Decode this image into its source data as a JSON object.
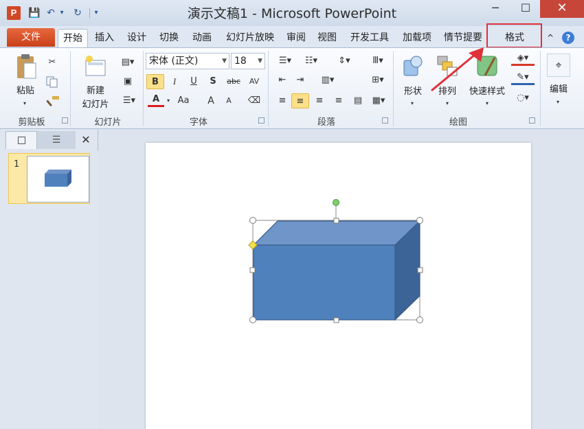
{
  "window": {
    "title": "演示文稿1 - Microsoft PowerPoint",
    "app_icon_letter": "P",
    "minimize": "─",
    "maximize": "☐",
    "close": "✕"
  },
  "quick_access": {
    "save": "💾",
    "undo": "↶",
    "undo_drop": "▾",
    "redo": "↻",
    "customize": "▾"
  },
  "tabs": {
    "file": "文件",
    "items": [
      "开始",
      "插入",
      "设计",
      "切换",
      "动画",
      "幻灯片放映",
      "审阅",
      "视图",
      "开发工具",
      "加载项",
      "情节提要",
      "格式"
    ],
    "active": "开始",
    "highlighted": "格式",
    "collapse": "^",
    "help": "?"
  },
  "ribbon": {
    "clipboard": {
      "paste": "粘贴",
      "label": "剪贴板"
    },
    "slides": {
      "new_slide_line1": "新建",
      "new_slide_line2": "幻灯片",
      "label": "幻灯片"
    },
    "font": {
      "name": "宋体 (正文)",
      "size": "18",
      "bold": "B",
      "italic": "I",
      "underline": "U",
      "shadow": "S",
      "strike": "abc",
      "spacing": "AV",
      "color": "A",
      "case": "Aa",
      "grow": "A",
      "shrink": "A",
      "label": "字体"
    },
    "paragraph": {
      "label": "段落"
    },
    "drawing": {
      "shapes": "形状",
      "arrange": "排列",
      "quick_styles": "快速样式",
      "label": "绘图"
    },
    "editing": {
      "label": "编辑"
    }
  },
  "slides_pane": {
    "close": "✕",
    "slide_number": "1"
  },
  "colors": {
    "shape_front": "#4f81bd",
    "shape_top": "#7095c8",
    "shape_side": "#3c6497",
    "highlight_box": "#e0303a",
    "file_tab": "#d24726"
  }
}
